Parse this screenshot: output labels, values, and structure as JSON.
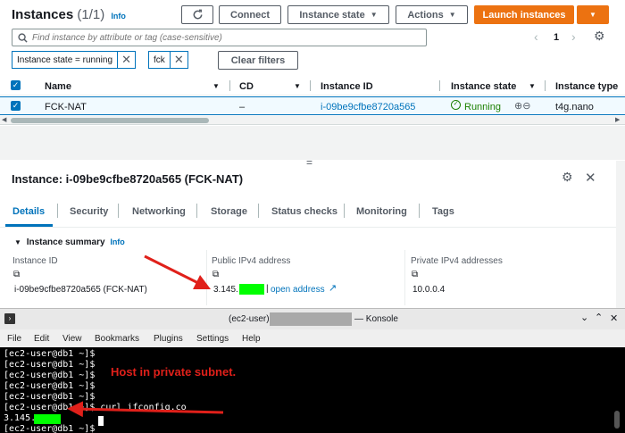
{
  "header": {
    "title": "Instances",
    "count": "(1/1)",
    "info": "Info",
    "connect": "Connect",
    "instance_state": "Instance state",
    "actions": "Actions",
    "launch": "Launch instances"
  },
  "search": {
    "placeholder": "Find instance by attribute or tag (case-sensitive)",
    "page": "1"
  },
  "filters": {
    "chip1": "Instance state = running",
    "chip2": "fck",
    "clear": "Clear filters"
  },
  "table": {
    "headers": [
      "Name",
      "CD",
      "Instance ID",
      "Instance state",
      "Instance type"
    ],
    "row": {
      "name": "FCK-NAT",
      "cd": "–",
      "id": "i-09be9cfbe8720a565",
      "state": "Running",
      "type": "t4g.nano"
    }
  },
  "detail": {
    "title": "Instance: i-09be9cfbe8720a565 (FCK-NAT)",
    "tabs": [
      "Details",
      "Security",
      "Networking",
      "Storage",
      "Status checks",
      "Monitoring",
      "Tags"
    ],
    "summary": "Instance summary",
    "info": "Info",
    "col1_label": "Instance ID",
    "col1_value": "i-09be9cfbe8720a565 (FCK-NAT)",
    "col2_label": "Public IPv4 address",
    "col2_value": "3.145.",
    "col2_link": "open address",
    "col3_label": "Private IPv4 addresses",
    "col3_value": "10.0.0.4"
  },
  "terminal": {
    "title_prefix": "(ec2-user)",
    "title_suffix": "— Konsole",
    "menu": [
      "File",
      "Edit",
      "View",
      "Bookmarks",
      "Plugins",
      "Settings",
      "Help"
    ],
    "lines": [
      "[ec2-user@db1 ~]$",
      "[ec2-user@db1 ~]$",
      "[ec2-user@db1 ~]$",
      "[ec2-user@db1 ~]$",
      "[ec2-user@db1 ~]$",
      "[ec2-user@db1 ~]$ curl ifconfig.co",
      "3.145.",
      "[ec2-user@db1 ~]$ "
    ],
    "annotation": "Host in private subnet."
  },
  "colors": {
    "accent": "#ec7211",
    "link": "#0073bb",
    "running": "#1d8102",
    "redacted_green": "#00ff00",
    "annotation_red": "#e0201a"
  }
}
